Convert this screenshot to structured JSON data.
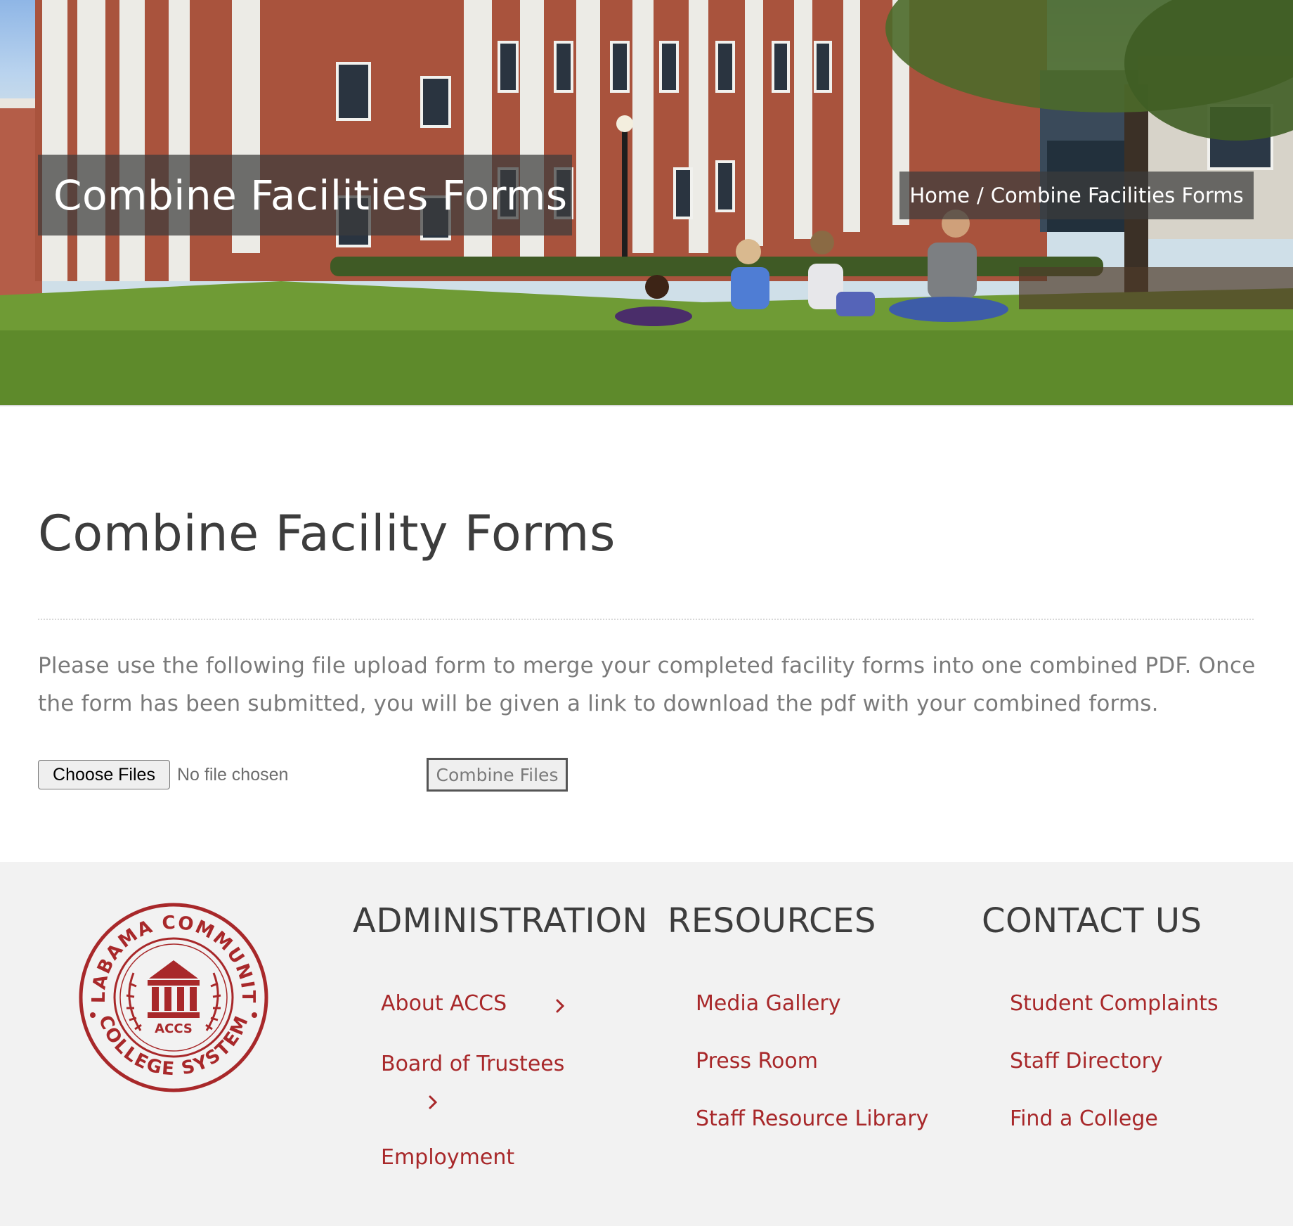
{
  "hero": {
    "title": "Combine Facilities Forms",
    "breadcrumb": {
      "home": "Home",
      "separator": "/",
      "current": "Combine Facilities Forms"
    }
  },
  "main": {
    "heading": "Combine Facility Forms",
    "intro": "Please use the following file upload form to merge your completed facility forms into one combined PDF. Once the form has been submitted, you will be given a link to download the pdf with your combined forms.",
    "file_input": {
      "button_label": "Choose Files",
      "status": "No file chosen"
    },
    "submit_label": "Combine Files"
  },
  "footer": {
    "logo": {
      "top_text": "ALABAMA COMMUNITY",
      "bottom_text": "COLLEGE SYSTEM",
      "center_text": "ACCS"
    },
    "administration": {
      "title": "ADMINISTRATION",
      "links": [
        "About ACCS",
        "Board of Trustees",
        "Employment"
      ]
    },
    "resources": {
      "title": "RESOURCES",
      "links": [
        "Media Gallery",
        "Press Room",
        "Staff Resource Library"
      ]
    },
    "contact": {
      "title": "CONTACT US",
      "links": [
        "Student Complaints",
        "Staff Directory",
        "Find a College"
      ]
    }
  },
  "colors": {
    "brand_red": "#a8282a",
    "heading_gray": "#3d3d3d",
    "body_gray": "#7a7a7a",
    "footer_bg": "#f2f2f2"
  },
  "icons": {
    "submenu_indicator": "chevron-right-icon",
    "logo": "building-columns-icon"
  }
}
